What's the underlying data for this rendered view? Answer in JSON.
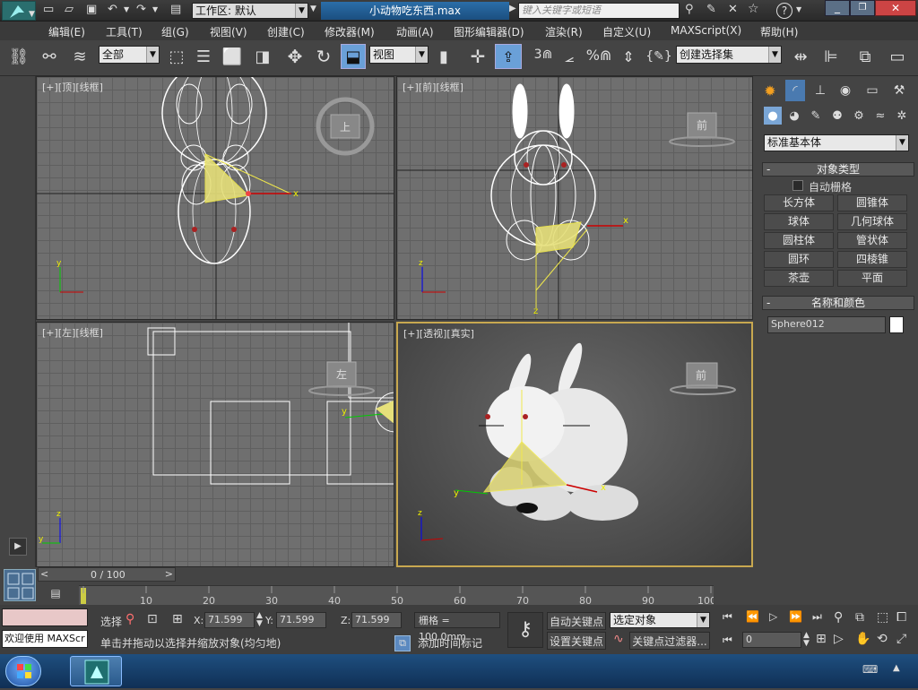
{
  "title": {
    "workspace_label": "工作区: 默认",
    "filename": "小动物吃东西.max",
    "search_placeholder": "键入关键字或短语"
  },
  "menu": [
    "编辑(E)",
    "工具(T)",
    "组(G)",
    "视图(V)",
    "创建(C)",
    "修改器(M)",
    "动画(A)",
    "图形编辑器(D)",
    "渲染(R)",
    "自定义(U)",
    "MAXScript(X)",
    "帮助(H)"
  ],
  "toolbar": {
    "filter": "全部",
    "refcoord": "视图",
    "selset": "创建选择集",
    "snap_num": "3",
    "angle": "%"
  },
  "viewports": {
    "top": {
      "label": "[+][顶][线框]",
      "cube": "上",
      "axis_x": "x",
      "axis_y": "y"
    },
    "front": {
      "label": "[+][前][线框]",
      "cube": "前",
      "axis_x": "x",
      "axis_z": "z"
    },
    "left": {
      "label": "[+][左][线框]",
      "cube": "左",
      "axis_y": "y",
      "axis_z": "z"
    },
    "persp": {
      "label": "[+][透视][真实]",
      "cube": "前",
      "axis_x": "x",
      "axis_y": "y",
      "axis_z": "z"
    }
  },
  "cmdpanel": {
    "category": "标准基本体",
    "objtype_header": "对象类型",
    "autogrid": "自动栅格",
    "buttons": [
      "长方体",
      "圆锥体",
      "球体",
      "几何球体",
      "圆柱体",
      "管状体",
      "圆环",
      "四棱锥",
      "茶壶",
      "平面"
    ],
    "namecolor_header": "名称和颜色",
    "object_name": "Sphere012",
    "object_color": "#ffffff"
  },
  "timeline": {
    "frame": "0 / 100",
    "ticks": [
      "10",
      "20",
      "30",
      "40",
      "50",
      "60",
      "70",
      "80",
      "90",
      "100"
    ]
  },
  "status": {
    "welcome": "欢迎使用 MAXScr",
    "sel_label": "选择",
    "x_label": "X:",
    "x": "71.599",
    "y_label": "Y:",
    "y": "71.599",
    "z_label": "Z:",
    "z": "71.599",
    "grid": "栅格 = 100.0mm",
    "auto_key": "自动关键点",
    "set_key": "设置关键点",
    "sel_obj": "选定对象",
    "key_filter": "关键点过滤器...",
    "prompt": "单击并拖动以选择并缩放对象(均匀地)",
    "add_time_tag": "添加时间标记",
    "frame_field": "0"
  }
}
